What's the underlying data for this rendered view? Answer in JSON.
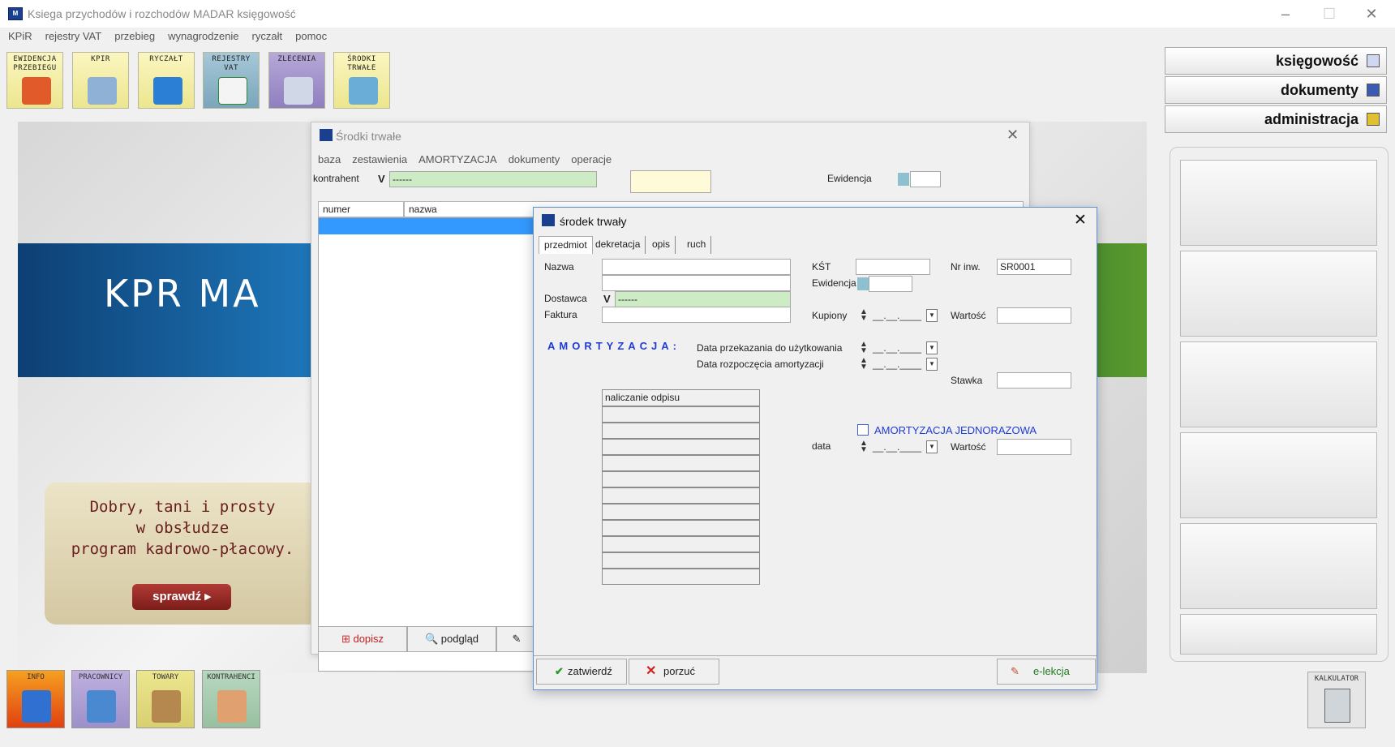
{
  "app": {
    "title": "Ksiega przychodów i rozchodów MADAR  księgowość",
    "menu": [
      "KPiR",
      "rejestry VAT",
      "przebieg",
      "wynagrodzenie",
      "ryczałt",
      "pomoc"
    ],
    "toolbar": [
      {
        "label": "EWIDENCJA PRZEBIEGU",
        "icon": "car-icon"
      },
      {
        "label": "KPIR",
        "icon": "book-icon"
      },
      {
        "label": "RYCZAŁT",
        "icon": "notebook-icon"
      },
      {
        "label": "REJESTRY VAT",
        "icon": "register-icon"
      },
      {
        "label": "ZLECENIA",
        "icon": "orders-icon"
      },
      {
        "label": "ŚRODKI TRWAŁE",
        "icon": "assets-icon"
      }
    ],
    "right_panel": [
      "księgowość",
      "dokumenty",
      "administracja"
    ],
    "bottom_buttons": [
      {
        "label": "INFO",
        "icon": "info-chart-icon"
      },
      {
        "label": "PRACOWNICY",
        "icon": "employee-icon"
      },
      {
        "label": "TOWARY",
        "icon": "box-icon"
      },
      {
        "label": "KONTRAHENCI",
        "icon": "handshake-icon"
      }
    ],
    "calc_label": "KALKULATOR"
  },
  "background": {
    "banner": "KPR MA",
    "promo_lines": [
      "Dobry, tani i prosty",
      "w obsłudze",
      "program kadrowo-płacowy."
    ],
    "promo_button": "sprawdź"
  },
  "srodki_window": {
    "title": "Środki trwałe",
    "menu": [
      "baza",
      "zestawienia",
      "AMORTYZACJA",
      "dokumenty",
      "operacje"
    ],
    "kontrahent_label": "kontrahent",
    "kontrahent_value": "------",
    "ewidencja_label": "Ewidencja",
    "columns": [
      "numer",
      "nazwa"
    ],
    "buttons": {
      "dopisz": "dopisz",
      "podglad": "podgląd"
    }
  },
  "dialog": {
    "title": "środek trwały",
    "tabs": [
      "przedmiot",
      "dekretacja",
      "opis",
      "ruch"
    ],
    "labels": {
      "nazwa": "Nazwa",
      "dostawca": "Dostawca",
      "faktura": "Faktura",
      "kst": "KŚT",
      "ewidencja": "Ewidencja",
      "kupiony": "Kupiony",
      "nr_inw": "Nr inw.",
      "wartosc": "Wartość",
      "amortyzacja": "AMORTYZACJA:",
      "data_przekazania": "Data przekazania do użytkowania",
      "data_rozpoczecia": "Data rozpoczęcia amortyzacji",
      "stawka": "Stawka",
      "grid_header": "naliczanie odpisu",
      "amort_jednorazowa": "AMORTYZACJA JEDNORAZOWA",
      "data": "data",
      "wartosc2": "Wartość"
    },
    "values": {
      "nr_inw": "SR0001",
      "dostawca": "------",
      "date_placeholder": "__.__.____"
    },
    "buttons": {
      "zatwierdz": "zatwierdź",
      "porzuc": "porzuć",
      "elekcja": "e-lekcja"
    }
  }
}
